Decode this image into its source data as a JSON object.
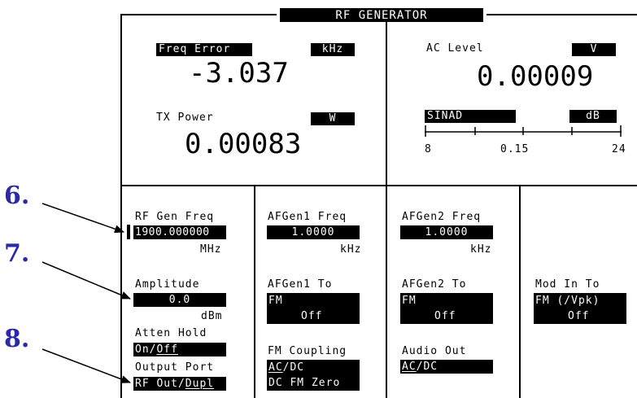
{
  "screen": {
    "title": "RF GENERATOR"
  },
  "measurements": {
    "freq_error": {
      "label": "Freq Error",
      "unit": "kHz",
      "value": "-3.037"
    },
    "tx_power": {
      "label": "TX Power",
      "unit": "W",
      "value": "0.00083"
    },
    "ac_level": {
      "label": "AC Level",
      "unit": "V",
      "value": "0.00009"
    },
    "sinad": {
      "label": "SINAD",
      "unit": "dB",
      "scale_min": "8",
      "scale_mid": "0.15",
      "scale_max": "24"
    }
  },
  "fields": {
    "rf_gen_freq": {
      "label": "RF Gen Freq",
      "value": "1900.000000",
      "unit": "MHz"
    },
    "amplitude": {
      "label": "Amplitude",
      "value": "0.0",
      "unit": "dBm"
    },
    "atten_hold": {
      "label": "Atten Hold",
      "on": "On",
      "sep": "/",
      "off": "Off"
    },
    "output_port": {
      "label": "Output Port",
      "opt1": "RF Out",
      "sep": "/",
      "opt2": "Dupl"
    },
    "afgen1_freq": {
      "label": "AFGen1 Freq",
      "value": "1.0000",
      "unit": "kHz"
    },
    "afgen1_to": {
      "label": "AFGen1 To",
      "line1": "FM",
      "line2": "Off"
    },
    "fm_coupling": {
      "label": "FM Coupling",
      "ac": "AC",
      "sep": "/",
      "dc": "DC",
      "line2": "DC FM Zero"
    },
    "afgen2_freq": {
      "label": "AFGen2 Freq",
      "value": "1.0000",
      "unit": "kHz"
    },
    "afgen2_to": {
      "label": "AFGen2 To",
      "line1": "FM",
      "line2": "Off"
    },
    "audio_out": {
      "label": "Audio Out",
      "ac": "AC",
      "sep": "/",
      "dc": "DC"
    },
    "mod_in_to": {
      "label": "Mod In To",
      "line1": "FM (/Vpk)",
      "line2": "Off"
    }
  },
  "callouts": [
    "6.",
    "7.",
    "8."
  ]
}
